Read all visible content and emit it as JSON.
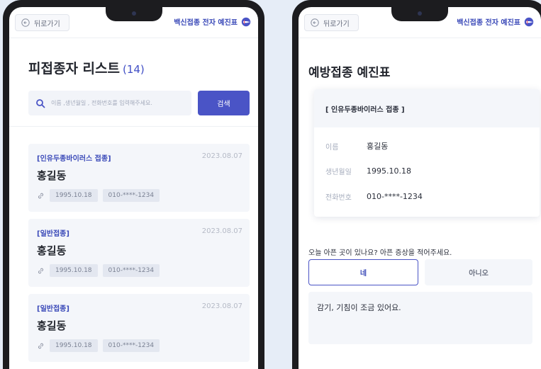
{
  "common": {
    "back_label": "뒤로가기",
    "brand_label": "백신접종 전자 예진표"
  },
  "list_screen": {
    "title": "피접종자 리스트",
    "count": "(14)",
    "search_placeholder": "이름 ,생년월일 , 전화번호를 입력해주세요.",
    "search_button": "검색",
    "records": [
      {
        "type": "[인유두종바이러스 접종]",
        "date": "2023.08.07",
        "name": "홍길동",
        "birth": "1995.10.18",
        "phone": "010-****-1234"
      },
      {
        "type": "[일반접종]",
        "date": "2023.08.07",
        "name": "홍길동",
        "birth": "1995.10.18",
        "phone": "010-****-1234"
      },
      {
        "type": "[일반접종]",
        "date": "2023.08.07",
        "name": "홍길동",
        "birth": "1995.10.18",
        "phone": "010-****-1234"
      }
    ]
  },
  "form_screen": {
    "title": "예방접종 예진표",
    "vaccine": "[ 인유두종바이러스 접종 ]",
    "fields": [
      {
        "label": "이름",
        "value": "홍길동"
      },
      {
        "label": "생년월일",
        "value": "1995.10.18"
      },
      {
        "label": "전화번호",
        "value": "010-****-1234"
      }
    ],
    "question": "오늘 아픈 곳이 있나요? 아픈 증상을 적어주세요.",
    "option_yes": "네",
    "option_no": "아니오",
    "symptom_text": "감기, 기침이 조금 있어요."
  },
  "colors": {
    "accent": "#4a54c6",
    "brand_text": "#3a49b8",
    "background": "#e6edf7",
    "card": "#f4f6fa"
  },
  "icons": [
    "back-arrow-icon",
    "syringe-icon",
    "search-icon",
    "link-icon"
  ]
}
